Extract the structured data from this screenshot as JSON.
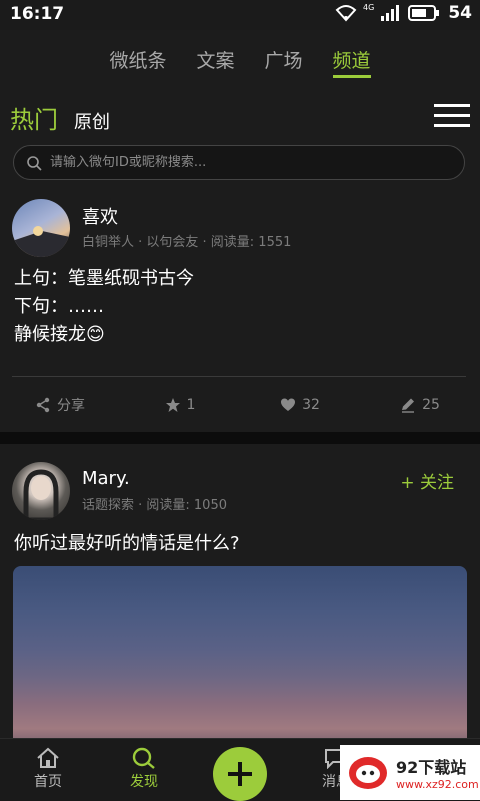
{
  "status": {
    "time": "16:17",
    "signal_label": "4G",
    "battery": "54"
  },
  "topnav": {
    "tabs": [
      {
        "label": "微纸条"
      },
      {
        "label": "文案"
      },
      {
        "label": "广场"
      },
      {
        "label": "频道"
      }
    ],
    "active": "频道"
  },
  "subtabs": {
    "hot": "热门",
    "original": "原创"
  },
  "search": {
    "placeholder": "请输入微句ID或昵称搜索..."
  },
  "posts": [
    {
      "username": "喜欢",
      "meta": "白铜举人 · 以句会友 · 阅读量: 1551",
      "lines": [
        "上句：笔墨纸砚书古今",
        "下句：……",
        "静候接龙😊"
      ],
      "actions": {
        "share": "分享",
        "star": "1",
        "like": "32",
        "comment": "25"
      }
    },
    {
      "username": "Mary.",
      "meta": "话题探索 · 阅读量: 1050",
      "follow": "+ 关注",
      "text": "你听过最好听的情话是什么?"
    }
  ],
  "bottomnav": {
    "home": "首页",
    "discover": "发现",
    "messages": "消息"
  },
  "watermark": {
    "title": "92下载站",
    "url": "www.xz92.com"
  },
  "colors": {
    "accent": "#9ccc3b",
    "background": "#1c1c1c"
  }
}
